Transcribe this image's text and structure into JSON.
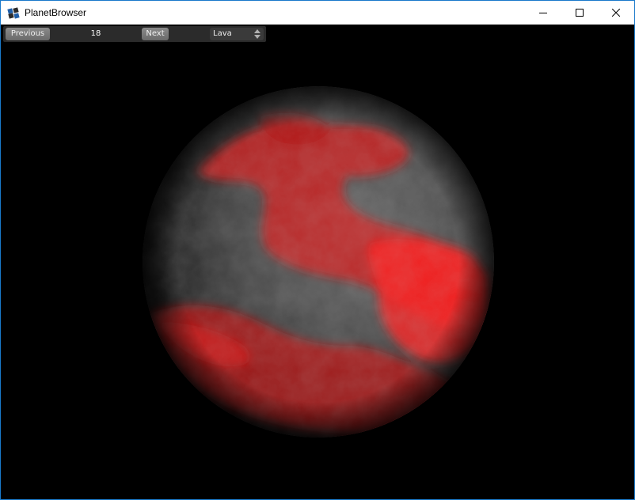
{
  "window": {
    "title": "PlanetBrowser",
    "accent_color": "#1979ca"
  },
  "toolbar": {
    "previous_label": "Previous",
    "index_value": "18",
    "next_label": "Next",
    "planet_type": "Lava"
  },
  "planet": {
    "surface_color": "#5a5a5a",
    "lava_color": "#ff1a1a",
    "background_color": "#000000"
  }
}
